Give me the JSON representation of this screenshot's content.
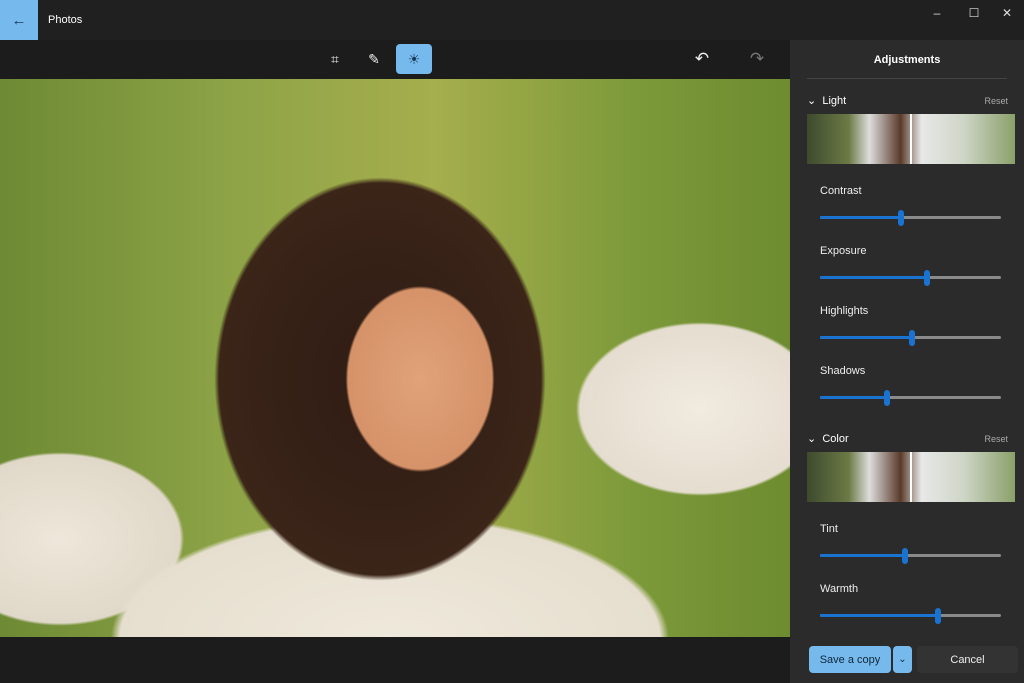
{
  "app": {
    "title": "Photos",
    "back_icon": "arrow-left-icon",
    "minimize": "–",
    "maximize": "☐",
    "close": "✕"
  },
  "toolbar": {
    "crop_icon": "⌗",
    "markup_icon": "✎",
    "adjust_icon": "☀",
    "undo_icon": "↶",
    "redo_icon": "↷",
    "active_tool": "adjust"
  },
  "panel": {
    "title": "Adjustments",
    "light": {
      "label": "Light",
      "reset": "Reset",
      "chevron": "⌄"
    },
    "color": {
      "label": "Color",
      "reset": "Reset",
      "chevron": "⌄"
    },
    "sliders": [
      {
        "label": "Contrast",
        "value": 0.45
      },
      {
        "label": "Exposure",
        "value": 0.59
      },
      {
        "label": "Highlights",
        "value": 0.51
      },
      {
        "label": "Shadows",
        "value": 0.37
      },
      {
        "label": "Tint",
        "value": 0.47
      },
      {
        "label": "Warmth",
        "value": 0.65
      }
    ],
    "save": "Save a copy",
    "save_dropdown": "⌄",
    "cancel": "Cancel"
  },
  "colors": {
    "accent": "#76b9ed",
    "slider": "#1a73d1"
  }
}
